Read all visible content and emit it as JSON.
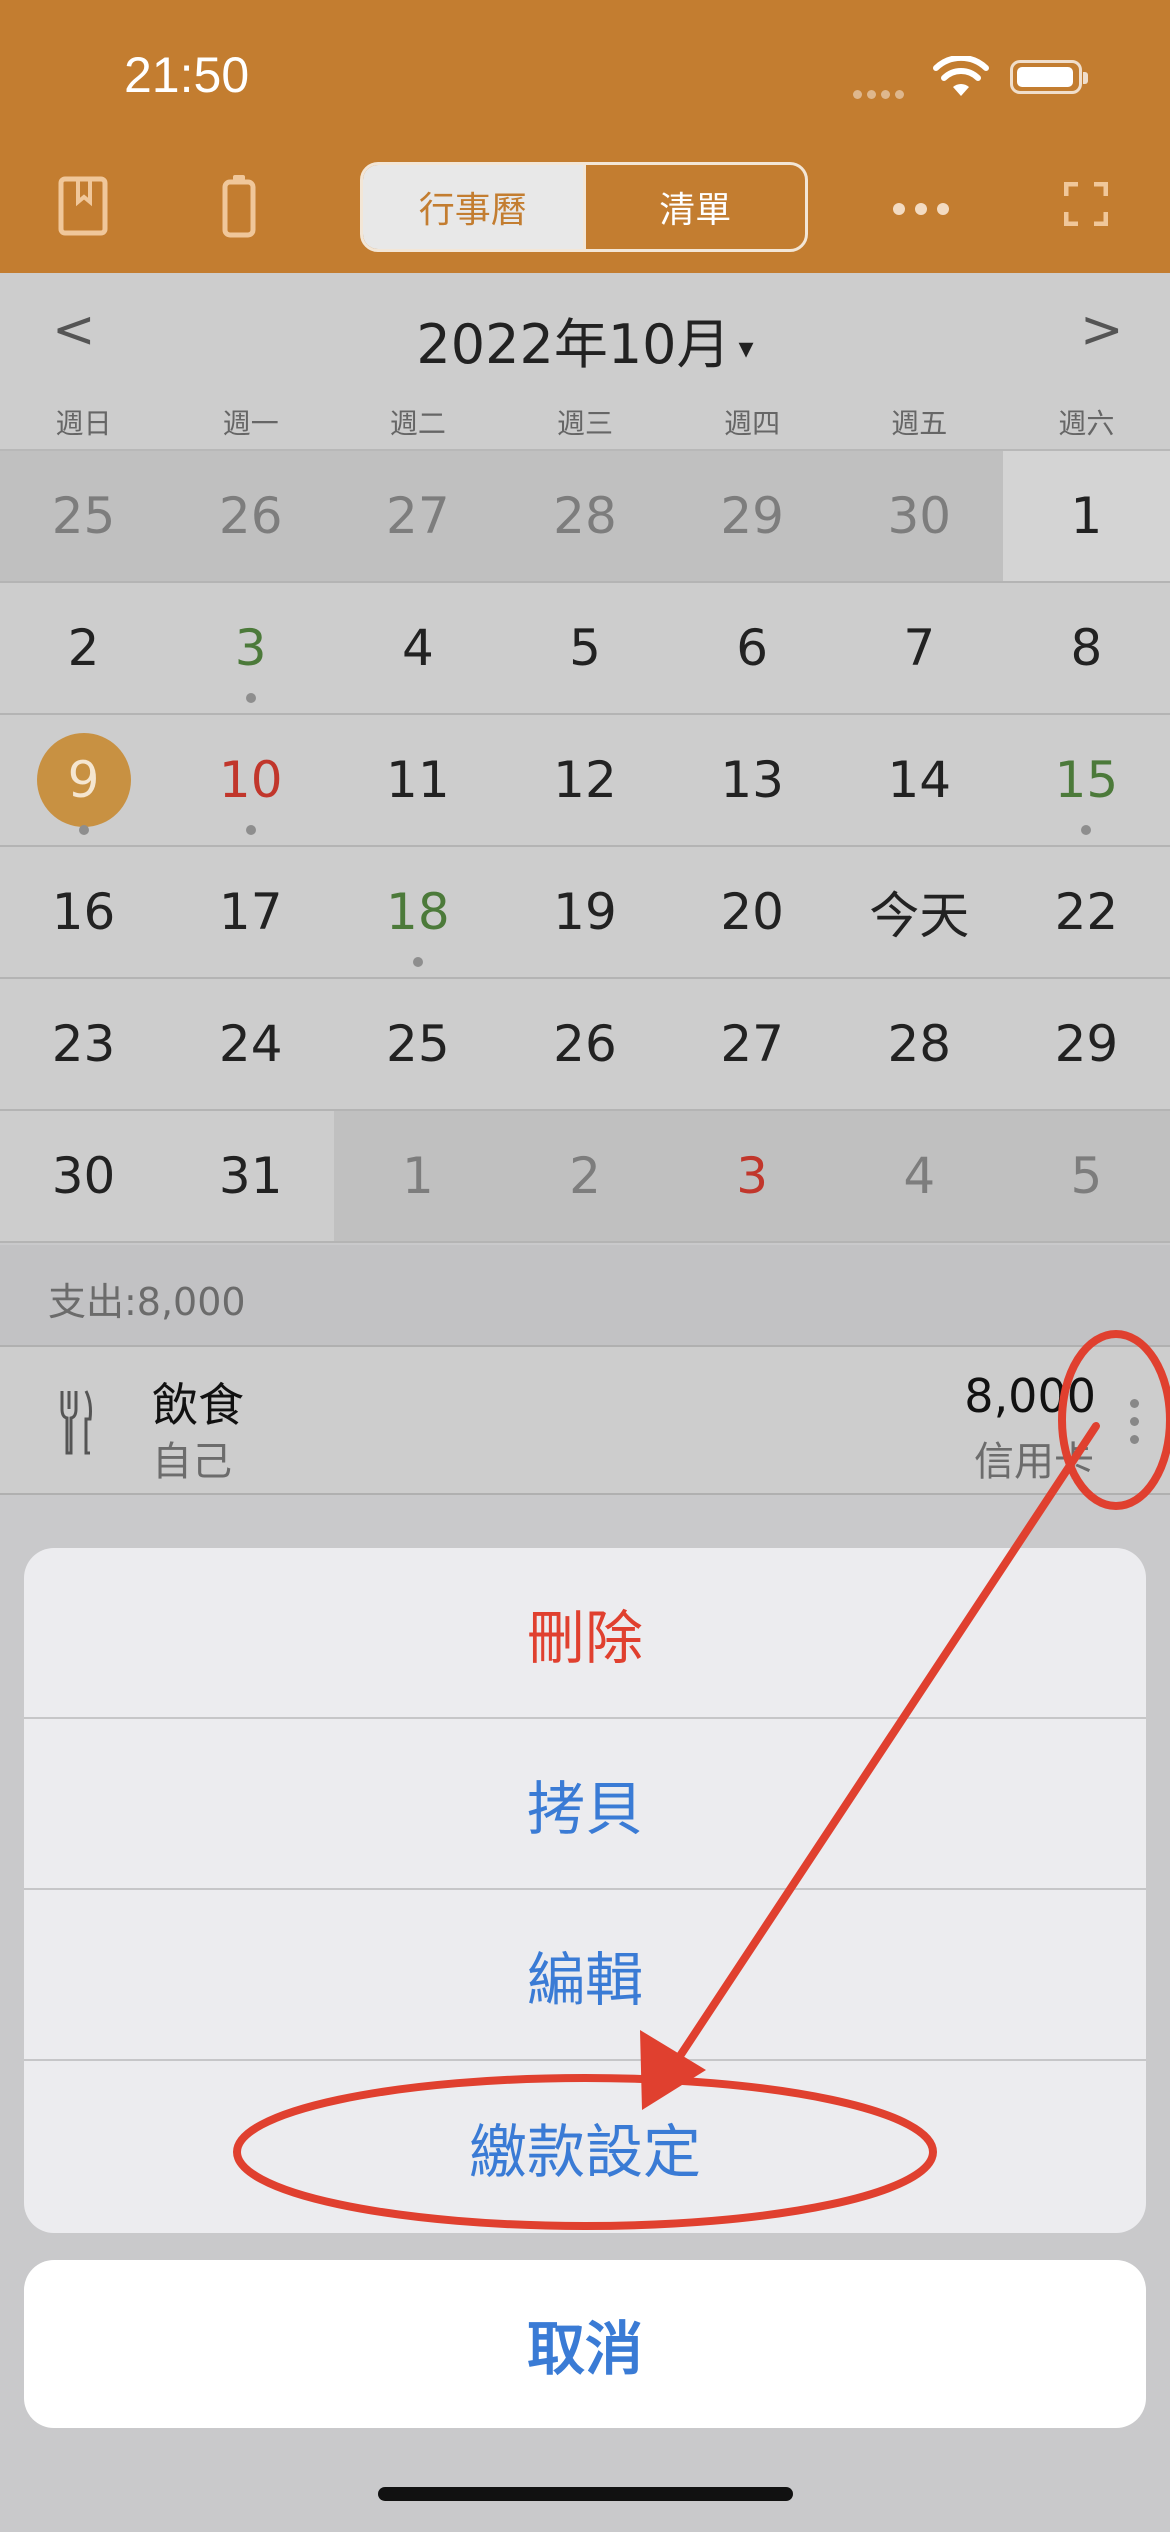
{
  "status_bar": {
    "time": "21:50"
  },
  "header": {
    "segments": [
      {
        "label": "行事曆",
        "selected": true
      },
      {
        "label": "清單",
        "selected": false
      }
    ],
    "accent_color": "#c37d30",
    "icons": [
      "bookmark-icon",
      "battery-outline-icon",
      "more-icon",
      "fullscreen-icon"
    ]
  },
  "calendar": {
    "prev": "<",
    "next": ">",
    "month_title": "2022年10月",
    "caret": "▾",
    "weekdays": [
      "週日",
      "週一",
      "週二",
      "週三",
      "週四",
      "週五",
      "週六"
    ],
    "weeks": [
      [
        {
          "t": "25",
          "out": true
        },
        {
          "t": "26",
          "out": true
        },
        {
          "t": "27",
          "out": true
        },
        {
          "t": "28",
          "out": true
        },
        {
          "t": "29",
          "out": true
        },
        {
          "t": "30",
          "out": true
        },
        {
          "t": "1",
          "cur": true
        }
      ],
      [
        {
          "t": "2"
        },
        {
          "t": "3",
          "color": "green",
          "dot": true
        },
        {
          "t": "4"
        },
        {
          "t": "5"
        },
        {
          "t": "6"
        },
        {
          "t": "7"
        },
        {
          "t": "8"
        }
      ],
      [
        {
          "t": "9",
          "selected": true,
          "dot": true
        },
        {
          "t": "10",
          "color": "red",
          "dot": true
        },
        {
          "t": "11"
        },
        {
          "t": "12"
        },
        {
          "t": "13"
        },
        {
          "t": "14"
        },
        {
          "t": "15",
          "color": "green",
          "dot": true
        }
      ],
      [
        {
          "t": "16"
        },
        {
          "t": "17"
        },
        {
          "t": "18",
          "color": "green",
          "dot": true
        },
        {
          "t": "19"
        },
        {
          "t": "20"
        },
        {
          "t": "今天"
        },
        {
          "t": "22"
        }
      ],
      [
        {
          "t": "23"
        },
        {
          "t": "24"
        },
        {
          "t": "25"
        },
        {
          "t": "26"
        },
        {
          "t": "27"
        },
        {
          "t": "28"
        },
        {
          "t": "29"
        }
      ],
      [
        {
          "t": "30"
        },
        {
          "t": "31"
        },
        {
          "t": "1",
          "out": true
        },
        {
          "t": "2",
          "out": true
        },
        {
          "t": "3",
          "out": true,
          "color": "red"
        },
        {
          "t": "4",
          "out": true
        },
        {
          "t": "5",
          "out": true
        }
      ]
    ]
  },
  "summary": {
    "text": "支出:8,000"
  },
  "entry": {
    "icon": "fork-knife-icon",
    "category": "飲食",
    "member": "自己",
    "amount": "8,000",
    "payment": "信用卡"
  },
  "action_sheet": {
    "actions": [
      {
        "label": "刪除",
        "style": "destructive"
      },
      {
        "label": "拷貝",
        "style": "default"
      },
      {
        "label": "編輯",
        "style": "default"
      },
      {
        "label": "繳款設定",
        "style": "default"
      }
    ],
    "cancel": "取消"
  },
  "annotation": {
    "color": "#e0402f"
  }
}
